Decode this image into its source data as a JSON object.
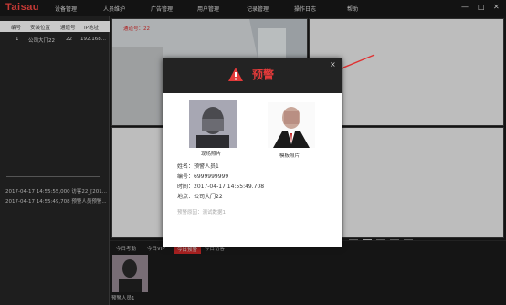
{
  "app": {
    "logo": "Taisau"
  },
  "nav": [
    "设备管理",
    "人员维护",
    "广告管理",
    "用户管理",
    "记录管理",
    "操作日志",
    "帮助"
  ],
  "window_controls": {
    "min": "—",
    "max": "□",
    "close": "✕"
  },
  "device_table": {
    "headers": [
      "编号",
      "安装位置",
      "通道号",
      "IP地址"
    ],
    "rows": [
      [
        "1",
        "公司大门22",
        "22",
        "192.168..."
      ]
    ]
  },
  "log": [
    "2017-04-17 14:55:55,000 访客22_[201...",
    "2017-04-17 14:55:49,708 预警人员预警..."
  ],
  "video": {
    "channel_label": "通道号：22"
  },
  "pager": [
    "‹",
    "1",
    "2",
    "3",
    "›"
  ],
  "bottom": {
    "tabs": [
      "今日考勤",
      "今日VIP",
      "今日预警",
      "今日访客"
    ],
    "active_tab": 2,
    "thumb_caption": "预警人员1"
  },
  "modal": {
    "title": "预警",
    "close": "×",
    "live_photo_caption": "现场照片",
    "template_photo_caption": "模板照片",
    "name": "姓名：预警人员1",
    "id": "编号：6999999999",
    "time": "时间：2017-04-17 14:55:49.708",
    "location": "地点：公司大门22",
    "reason": "预警原因：测试数据1"
  },
  "colors": {
    "accent": "#d52a2a",
    "logo": "#c73a36",
    "modal_header": "#232323"
  },
  "icons": {
    "warning": "warning-triangle-icon",
    "close": "close-icon"
  }
}
